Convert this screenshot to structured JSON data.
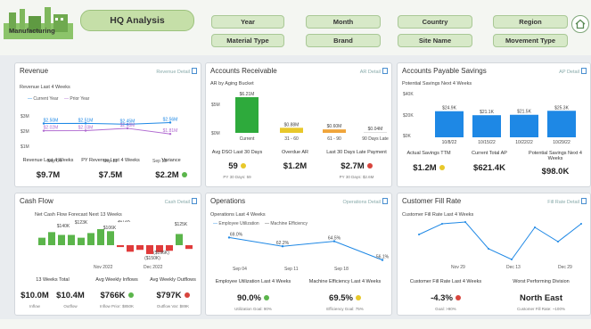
{
  "header": {
    "logo_label": "Manufacturing",
    "title": "HQ Analysis",
    "filters": [
      "Year",
      "Month",
      "Country",
      "Region",
      "Material Type",
      "Brand",
      "Site Name",
      "Movement Type"
    ]
  },
  "colors": {
    "accent_green": "#5bb54b",
    "bar_blue": "#1e88e5",
    "neg_red": "#e03b3b"
  },
  "revenue": {
    "title": "Revenue",
    "detail": "Revenue Detail",
    "subtitle": "Revenue Last 4 Weeks",
    "legend": [
      "Current Year",
      "Prior Year"
    ],
    "chart_data": {
      "type": "line",
      "x": [
        "Sep 04",
        "Sep 11",
        "Sep 18"
      ],
      "y_ticks": [
        "$3M",
        "$2M",
        "$1M"
      ],
      "series": [
        {
          "name": "Current Year",
          "values": [
            2.5,
            2.51,
            2.45,
            2.56
          ],
          "labels": [
            "$2.50M",
            "$2.51M",
            "$2.45M",
            "$2.56M"
          ]
        },
        {
          "name": "Prior Year",
          "values": [
            2.02,
            2.03,
            2.18,
            1.81
          ],
          "labels": [
            "$2.02M",
            "$2.03M",
            "$2.18M",
            "$1.81M"
          ]
        }
      ]
    },
    "kpis": [
      {
        "label": "Revenue Last 4 Weeks",
        "value": "$9.7M"
      },
      {
        "label": "PY Revenue Last 4 Weeks",
        "value": "$7.5M"
      },
      {
        "label": "Variance",
        "value": "$2.2M",
        "status": "green"
      }
    ]
  },
  "ar": {
    "title": "Accounts Receivable",
    "detail": "AR Detail",
    "subtitle": "AR by Aging Bucket",
    "chart_data": {
      "type": "bar",
      "categories": [
        "Current",
        "31 - 60",
        "61 - 90",
        "90 Days Late"
      ],
      "values": [
        6.21,
        0.88,
        0.6,
        0.04
      ],
      "labels": [
        "$6.21M",
        "$0.88M",
        "$0.60M",
        "$0.04M"
      ],
      "y_ticks": [
        "$5M",
        "$0M"
      ]
    },
    "kpis": [
      {
        "label": "Avg DSO Last 30 Days",
        "value": "59",
        "sub": "PY 30 Days: 59",
        "status": "yellow"
      },
      {
        "label": "Overdue AR",
        "value": "$1.2M"
      },
      {
        "label": "Last 30 Days Late Payment",
        "value": "$2.7M",
        "sub": "PY 30 Days: $2.6M",
        "status": "red"
      }
    ]
  },
  "ap": {
    "title": "Accounts Payable Savings",
    "detail": "AP Detail",
    "subtitle": "Potential Savings Next 4 Weeks",
    "chart_data": {
      "type": "bar",
      "categories": [
        "10/8/22",
        "10/15/22",
        "10/22/22",
        "10/29/22"
      ],
      "values": [
        24.9,
        21.1,
        21.5,
        25.3
      ],
      "labels": [
        "$24.9K",
        "$21.1K",
        "$21.5K",
        "$25.3K"
      ],
      "y_ticks": [
        "$40K",
        "$20K",
        "$0K"
      ]
    },
    "kpis": [
      {
        "label": "Actual Savings TTM",
        "value": "$1.2M",
        "status": "yellow"
      },
      {
        "label": "Current Total AP",
        "value": "$621.4K"
      },
      {
        "label": "Potential Savings Next 4 Weeks",
        "value": "$98.0K"
      }
    ]
  },
  "cashflow": {
    "title": "Cash Flow",
    "detail": "Cash Detail",
    "subtitle": "Net Cash Flow Forecast Next 13 Weeks",
    "chart_data": {
      "type": "bar",
      "x_ticks": [
        "Nov 2022",
        "Dec 2022"
      ],
      "values": [
        80,
        140,
        110,
        110,
        80,
        130,
        172,
        150,
        -20,
        -70,
        -50,
        -95,
        -75,
        -60,
        120,
        -40
      ],
      "labels": [
        "$140K",
        "$123K",
        "$106K",
        "$172K",
        "($150K)",
        "($196K)",
        "$125K"
      ]
    },
    "kpis": [
      {
        "label": "13 Weeks Total",
        "value": "$10.0M",
        "sub": "Inflow"
      },
      {
        "label": "",
        "value": "$10.4M",
        "sub": "Outflow"
      },
      {
        "label": "Avg Weekly Inflows",
        "value": "$766K",
        "sub": "Inflow Prior: $850K",
        "status": "green"
      },
      {
        "label": "Avg Weekly Outflows",
        "value": "$797K",
        "sub": "Outflow Var: $89K",
        "status": "red"
      }
    ]
  },
  "ops": {
    "title": "Operations",
    "detail": "Operations Detail",
    "subtitle": "Operations Last 4 Weeks",
    "legend": [
      "Employee Utilization",
      "Machine Efficiency"
    ],
    "chart_data": {
      "type": "line",
      "x": [
        "Sep 04",
        "Sep 11",
        "Sep 18"
      ],
      "series": [
        {
          "name": "Machine Efficiency",
          "values": [
            69,
            62,
            66,
            51
          ],
          "labels": [
            "69.0%",
            "62.2%",
            "64.5%",
            "56.1%"
          ]
        }
      ]
    },
    "kpis": [
      {
        "label": "Employee Utilization Last 4 Weeks",
        "value": "90.0%",
        "sub": "Utilization Goal: 90%",
        "status": "green"
      },
      {
        "label": "Machine Efficiency Last 4 Weeks",
        "value": "69.5%",
        "sub": "Efficiency Goal: 75%",
        "status": "yellow"
      }
    ]
  },
  "fill": {
    "title": "Customer Fill Rate",
    "detail": "Fill Rate Detail",
    "subtitle": "Customer Fill Rate Last 4 Weeks",
    "chart_data": {
      "type": "line",
      "x": [
        "Nov 29",
        "Dec 13",
        "Dec 29"
      ],
      "values": [
        96,
        99,
        99.5,
        92,
        89,
        98,
        94,
        99
      ]
    },
    "kpis": [
      {
        "label": "Customer Fill Rate Last 4 Weeks",
        "value": "-4.3%",
        "sub": "Goal: >90%",
        "status": "red"
      },
      {
        "label": "Worst Performing Division",
        "value": "North East",
        "sub": "Customer Fill Rate: ~100%"
      }
    ]
  }
}
